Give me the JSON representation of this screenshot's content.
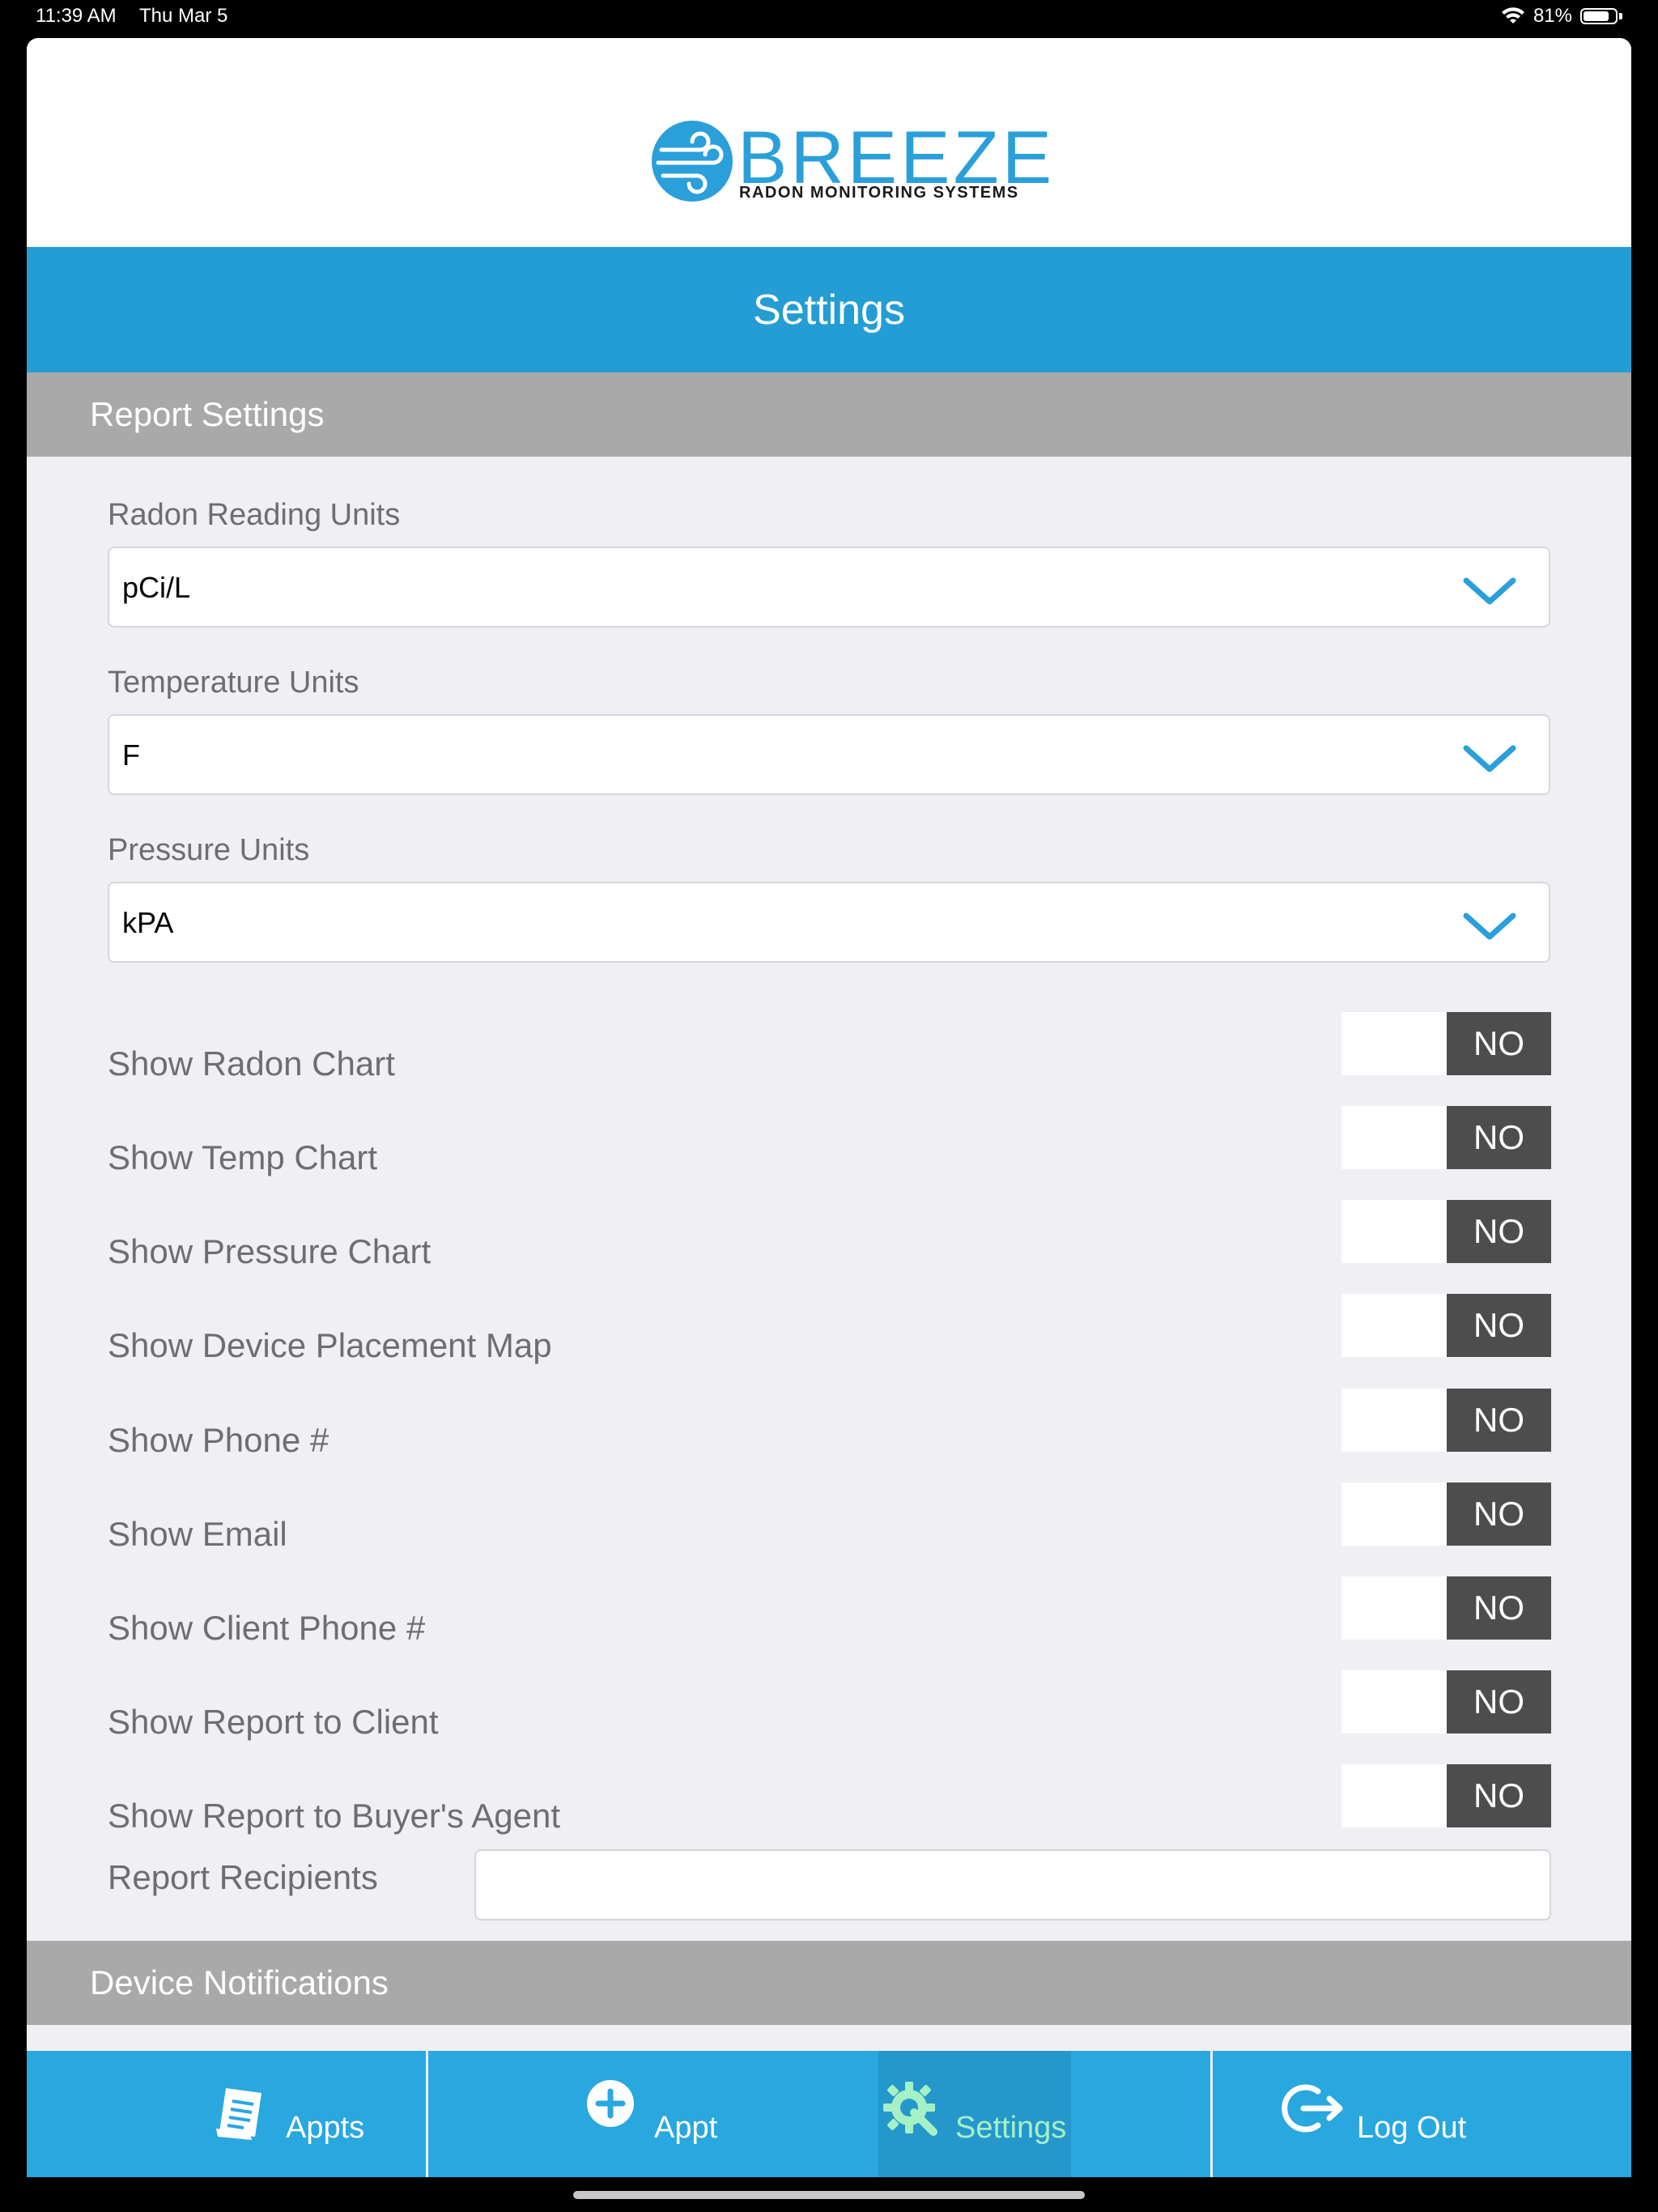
{
  "status_bar": {
    "time": "11:39 AM",
    "date": "Thu Mar 5",
    "battery_text": "81%",
    "battery_level": 0.81
  },
  "logo": {
    "word": "BREEZE",
    "tagline": "RADON MONITORING SYSTEMS"
  },
  "header": {
    "title": "Settings"
  },
  "sections": {
    "report": "Report Settings",
    "notifications": "Device Notifications"
  },
  "selects": {
    "radon": {
      "label": "Radon Reading Units",
      "value": "pCi/L"
    },
    "temperature": {
      "label": "Temperature Units",
      "value": "F"
    },
    "pressure": {
      "label": "Pressure Units",
      "value": "kPA"
    }
  },
  "toggles": [
    {
      "label": "Show Radon Chart",
      "state": "NO"
    },
    {
      "label": "Show Temp Chart",
      "state": "NO"
    },
    {
      "label": "Show Pressure Chart",
      "state": "NO"
    },
    {
      "label": "Show Device Placement Map",
      "state": "NO"
    },
    {
      "label": "Show Phone #",
      "state": "NO"
    },
    {
      "label": "Show Email",
      "state": "NO"
    },
    {
      "label": "Show Client Phone #",
      "state": "NO"
    },
    {
      "label": "Show Report to Client",
      "state": "NO"
    },
    {
      "label": "Show Report to Buyer's Agent",
      "state": "NO"
    }
  ],
  "recipients": {
    "label": "Report Recipients",
    "value": "",
    "placeholder": ""
  },
  "tabs": [
    {
      "label": "Appts",
      "icon": "document-list-icon",
      "active": false
    },
    {
      "label": "Appt",
      "icon": "plus-circle-icon",
      "active": false
    },
    {
      "label": "Settings",
      "icon": "gear-wrench-icon",
      "active": true
    },
    {
      "label": "Log Out",
      "icon": "logout-icon",
      "active": false
    }
  ],
  "colors": {
    "accent": "#249dd4",
    "tab_bar": "#29a7df",
    "section_header": "#a9a9a9",
    "toggle_off": "#4d4d4d",
    "active_tab_text": "#a6f0c6"
  }
}
